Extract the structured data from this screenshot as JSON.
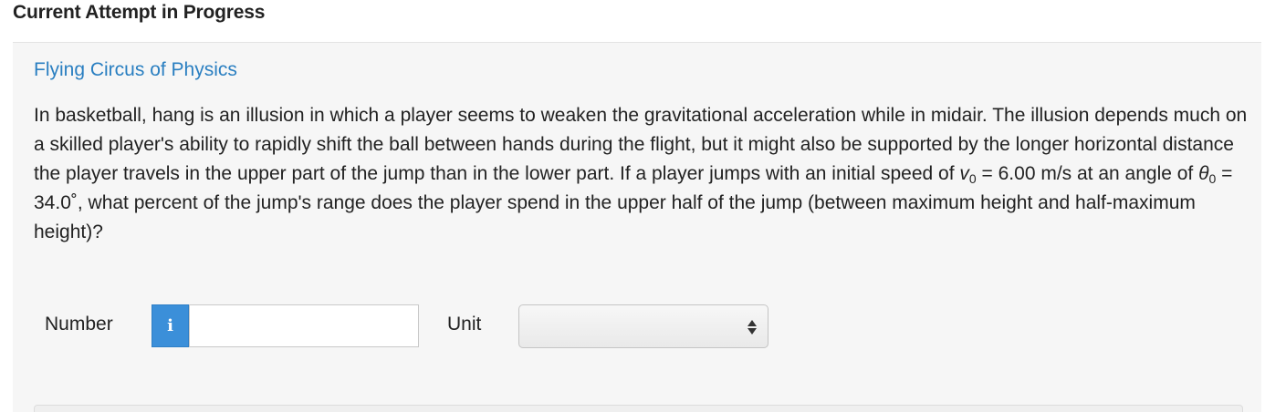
{
  "header": {
    "title": "Current Attempt in Progress"
  },
  "problem": {
    "source": "Flying Circus of Physics",
    "text_part1": "In basketball, hang is an illusion in which a player seems to weaken the gravitational acceleration while in midair. The illusion depends much on a skilled player's ability to rapidly shift the ball between hands during the flight, but it might also be supported by the longer horizontal distance the player travels in the upper part of the jump than in the lower part. If a player jumps with an initial speed of ",
    "v_symbol": "v",
    "v_sub": "0",
    "v_value": " = 6.00 m/s at an angle of ",
    "theta_symbol": "θ",
    "theta_sub": "0",
    "theta_value": " = 34.0˚, what percent of the jump's range does the player spend in the upper half of the jump (between maximum height and half-maximum height)?"
  },
  "answer": {
    "number_label": "Number",
    "info_icon_glyph": "i",
    "number_value": "",
    "unit_label": "Unit",
    "unit_selected": ""
  },
  "colors": {
    "link_blue": "#2a7fc1",
    "info_button_blue": "#3b8fd9",
    "panel_bg": "#f6f6f6"
  }
}
